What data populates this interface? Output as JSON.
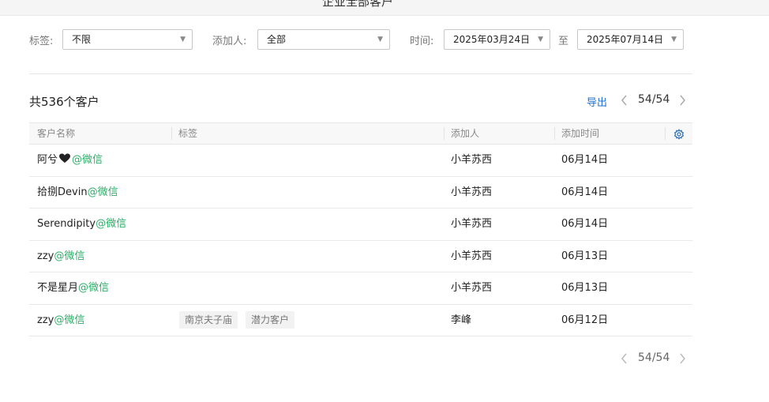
{
  "header": {
    "title": "企业全部客户"
  },
  "filters": {
    "tag_label": "标签:",
    "tag_value": "不限",
    "adder_label": "添加人:",
    "adder_value": "全部",
    "time_label": "时间:",
    "date_from": "2025年03月24日",
    "to_label": "至",
    "date_to": "2025年07月14日"
  },
  "summary": {
    "total": "共536个客户",
    "export_label": "导出",
    "page": "54/54"
  },
  "table": {
    "columns": [
      "客户名称",
      "标签",
      "添加人",
      "添加时间"
    ],
    "rows": [
      {
        "name": "阿兮",
        "heart": true,
        "channel": "@微信",
        "tags": [],
        "adder": "小羊苏西",
        "time": "06月14日"
      },
      {
        "name": "拾捌Devin",
        "heart": false,
        "channel": "@微信",
        "tags": [],
        "adder": "小羊苏西",
        "time": "06月14日"
      },
      {
        "name": "Serendipity",
        "heart": false,
        "channel": "@微信",
        "tags": [],
        "adder": "小羊苏西",
        "time": "06月14日"
      },
      {
        "name": "zzy",
        "heart": false,
        "channel": "@微信",
        "tags": [],
        "adder": "小羊苏西",
        "time": "06月13日"
      },
      {
        "name": "不是星月",
        "heart": false,
        "channel": "@微信",
        "tags": [],
        "adder": "小羊苏西",
        "time": "06月13日"
      },
      {
        "name": "zzy",
        "heart": false,
        "channel": "@微信",
        "tags": [
          "南京夫子庙",
          "潜力客户"
        ],
        "adder": "李峰",
        "time": "06月12日"
      }
    ]
  },
  "footer": {
    "page": "54/54"
  },
  "colors": {
    "accent": "#1e6fd0",
    "wechat": "#2aae67"
  }
}
